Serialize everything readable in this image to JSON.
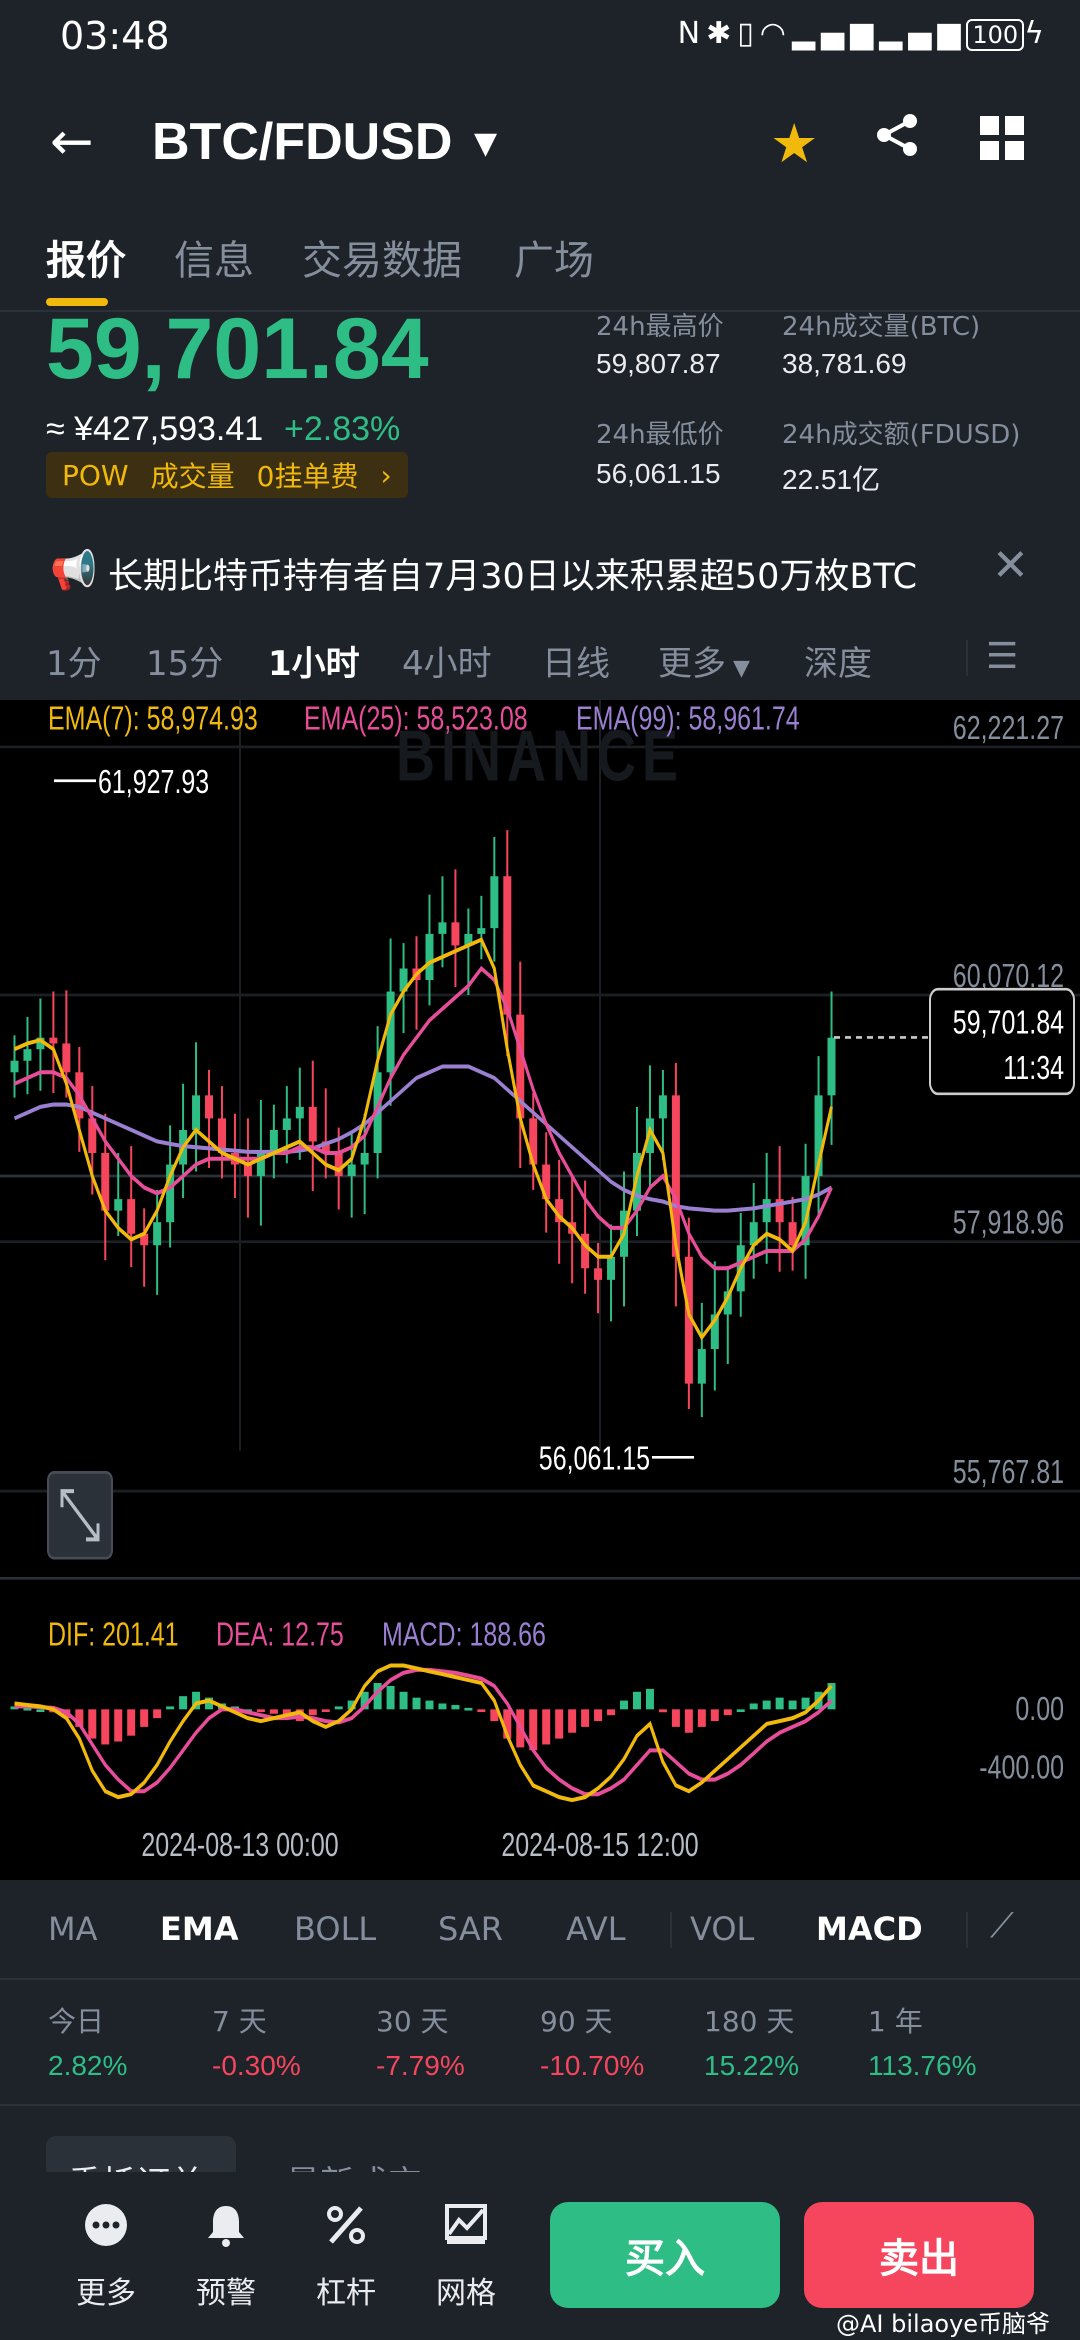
{
  "status_bar": {
    "time": "03:48",
    "battery": "100"
  },
  "header": {
    "back_icon": "arrow-left-icon",
    "pair": "BTC/FDUSD",
    "favorite_icon": "star-icon",
    "share_icon": "share-icon",
    "grid_icon": "grid-icon"
  },
  "tabs": [
    {
      "label": "报价",
      "active": true
    },
    {
      "label": "信息",
      "active": false
    },
    {
      "label": "交易数据",
      "active": false
    },
    {
      "label": "广场",
      "active": false
    }
  ],
  "price": {
    "last": "59,701.84",
    "cny": "≈ ¥427,593.41",
    "change": "+2.83%",
    "tags": [
      "POW",
      "成交量",
      "0挂单费"
    ]
  },
  "stats": {
    "high_label": "24h最高价",
    "high": "59,807.87",
    "vol_btc_label": "24h成交量(BTC)",
    "vol_btc": "38,781.69",
    "low_label": "24h最低价",
    "low": "56,061.15",
    "vol_q_label": "24h成交额(FDUSD)",
    "vol_q": "22.51亿"
  },
  "notice": {
    "text": "长期比特币持有者自7月30日以来积累超50万枚BTC"
  },
  "intervals": [
    {
      "label": "1分",
      "active": false
    },
    {
      "label": "15分",
      "active": false
    },
    {
      "label": "1小时",
      "active": true
    },
    {
      "label": "4小时",
      "active": false
    },
    {
      "label": "日线",
      "active": false
    },
    {
      "label": "更多",
      "active": false
    },
    {
      "label": "深度",
      "active": false
    }
  ],
  "chart_data": {
    "type": "candlestick",
    "title": "BTC/FDUSD 1h",
    "indicators": {
      "ema7_label": "EMA(7): 58,974.93",
      "ema25_label": "EMA(25): 58,523.08",
      "ema99_label": "EMA(99): 58,961.74"
    },
    "y_ticks": [
      "62,221.27",
      "60,070.12",
      "57,918.96",
      "55,767.81"
    ],
    "ylim": [
      55767.81,
      62221.27
    ],
    "last_price_label": "59,701.84",
    "countdown": "11:34",
    "annotations": {
      "high": "61,927.93",
      "low": "56,061.15"
    },
    "x_ticks": [
      "2024-08-13 00:00",
      "2024-08-15 12:00"
    ],
    "watermark": "BINANCE",
    "close_series": [
      59500,
      59600,
      59700,
      59650,
      59400,
      59000,
      58700,
      58200,
      58300,
      58000,
      57900,
      58100,
      58600,
      58900,
      59200,
      59000,
      58700,
      58600,
      58500,
      58700,
      58900,
      59000,
      59100,
      58800,
      58700,
      58500,
      58600,
      58700,
      59400,
      60100,
      60300,
      60200,
      60600,
      60700,
      60500,
      60600,
      60650,
      61100,
      59900,
      59000,
      58600,
      58300,
      58100,
      58000,
      57700,
      57600,
      57800,
      58200,
      58700,
      59000,
      59200,
      57800,
      56700,
      57000,
      57300,
      57500,
      57900,
      58100,
      58300,
      58100,
      57900,
      58500,
      59200,
      59700
    ],
    "ema7_series": [
      59600,
      59650,
      59680,
      59600,
      59300,
      58900,
      58500,
      58200,
      58050,
      57950,
      58000,
      58200,
      58500,
      58750,
      58900,
      58800,
      58700,
      58650,
      58600,
      58650,
      58700,
      58750,
      58800,
      58700,
      58600,
      58550,
      58650,
      59000,
      59500,
      59900,
      60100,
      60250,
      60350,
      60400,
      60450,
      60500,
      60550,
      60300,
      59600,
      59000,
      58600,
      58300,
      58150,
      58050,
      57900,
      57800,
      57800,
      58000,
      58500,
      58900,
      58700,
      57900,
      57300,
      57100,
      57250,
      57450,
      57700,
      57900,
      58000,
      57950,
      57850,
      58100,
      58600,
      59100
    ],
    "ema25_series": [
      59300,
      59350,
      59400,
      59400,
      59350,
      59200,
      59000,
      58800,
      58650,
      58500,
      58400,
      58350,
      58400,
      58500,
      58600,
      58650,
      58650,
      58650,
      58650,
      58650,
      58700,
      58700,
      58750,
      58750,
      58700,
      58700,
      58750,
      58850,
      59100,
      59350,
      59550,
      59700,
      59850,
      59950,
      60050,
      60150,
      60300,
      60200,
      59950,
      59600,
      59250,
      58950,
      58700,
      58500,
      58300,
      58150,
      58050,
      58050,
      58200,
      58400,
      58500,
      58300,
      58000,
      57800,
      57700,
      57700,
      57750,
      57800,
      57850,
      57850,
      57850,
      57950,
      58150,
      58400
    ],
    "ema99_series": [
      59000,
      59050,
      59100,
      59120,
      59120,
      59100,
      59050,
      59000,
      58950,
      58900,
      58850,
      58800,
      58780,
      58760,
      58750,
      58740,
      58730,
      58720,
      58710,
      58710,
      58710,
      58710,
      58720,
      58740,
      58780,
      58820,
      58880,
      58950,
      59050,
      59150,
      59250,
      59350,
      59400,
      59450,
      59450,
      59450,
      59400,
      59350,
      59250,
      59150,
      59050,
      58950,
      58850,
      58750,
      58650,
      58550,
      58450,
      58380,
      58330,
      58300,
      58280,
      58240,
      58220,
      58210,
      58200,
      58200,
      58210,
      58220,
      58240,
      58260,
      58280,
      58300,
      58340,
      58400
    ],
    "macd": {
      "dif_label": "DIF: 201.41",
      "dea_label": "DEA: 12.75",
      "macd_label": "MACD: 188.66",
      "y_ticks": [
        "0.00",
        "-400.00"
      ],
      "ylim": [
        -800,
        300
      ],
      "histogram": [
        20,
        10,
        0,
        -20,
        -60,
        -120,
        -200,
        -240,
        -220,
        -180,
        -120,
        -60,
        20,
        90,
        120,
        80,
        40,
        20,
        0,
        -10,
        -30,
        -60,
        -80,
        -40,
        -10,
        20,
        60,
        120,
        180,
        160,
        120,
        80,
        60,
        40,
        30,
        10,
        -10,
        -80,
        -200,
        -260,
        -280,
        -240,
        -200,
        -160,
        -120,
        -80,
        -40,
        60,
        120,
        140,
        -20,
        -120,
        -160,
        -120,
        -80,
        -40,
        0,
        40,
        60,
        80,
        60,
        80,
        120,
        180
      ],
      "dif": [
        40,
        30,
        20,
        0,
        -60,
        -200,
        -420,
        -560,
        -600,
        -580,
        -500,
        -380,
        -220,
        -80,
        40,
        60,
        20,
        -20,
        -60,
        -80,
        -60,
        -40,
        -20,
        -80,
        -120,
        -80,
        0,
        160,
        260,
        300,
        300,
        280,
        260,
        240,
        220,
        200,
        180,
        60,
        -180,
        -380,
        -520,
        -560,
        -600,
        -620,
        -600,
        -540,
        -460,
        -340,
        -180,
        -100,
        -360,
        -520,
        -560,
        -500,
        -420,
        -340,
        -260,
        -180,
        -100,
        -80,
        -60,
        -20,
        60,
        160
      ],
      "dea": [
        20,
        20,
        15,
        10,
        -20,
        -100,
        -240,
        -380,
        -480,
        -560,
        -560,
        -500,
        -400,
        -280,
        -160,
        -60,
        0,
        0,
        -20,
        -40,
        -60,
        -60,
        -50,
        -60,
        -80,
        -90,
        -60,
        20,
        120,
        200,
        250,
        270,
        270,
        260,
        250,
        230,
        210,
        160,
        40,
        -120,
        -280,
        -400,
        -480,
        -540,
        -580,
        -580,
        -540,
        -480,
        -380,
        -280,
        -280,
        -360,
        -440,
        -480,
        -480,
        -440,
        -380,
        -300,
        -220,
        -160,
        -120,
        -80,
        -20,
        60
      ]
    }
  },
  "indicator_tabs": [
    {
      "label": "MA",
      "active": false
    },
    {
      "label": "EMA",
      "active": true
    },
    {
      "label": "BOLL",
      "active": false
    },
    {
      "label": "SAR",
      "active": false
    },
    {
      "label": "AVL",
      "active": false
    },
    {
      "label": "VOL",
      "active": false
    },
    {
      "label": "MACD",
      "active": true
    }
  ],
  "performance": [
    {
      "label": "今日",
      "value": "2.82%",
      "up": true
    },
    {
      "label": "7 天",
      "value": "-0.30%",
      "up": false
    },
    {
      "label": "30 天",
      "value": "-7.79%",
      "up": false
    },
    {
      "label": "90 天",
      "value": "-10.70%",
      "up": false
    },
    {
      "label": "180 天",
      "value": "15.22%",
      "up": true
    },
    {
      "label": "1 年",
      "value": "113.76%",
      "up": true
    }
  ],
  "peek_tabs": [
    "委托订单",
    "最新成交"
  ],
  "bottom_nav": [
    {
      "label": "更多",
      "icon": "more-icon"
    },
    {
      "label": "预警",
      "icon": "bell-icon"
    },
    {
      "label": "杠杆",
      "icon": "leverage-icon"
    },
    {
      "label": "网格",
      "icon": "grid-trading-icon"
    }
  ],
  "actions": {
    "buy": "买入",
    "sell": "卖出"
  },
  "watermark": "@AI bilaoye币脑爷",
  "colors": {
    "up": "#2ebd85",
    "down": "#f6465d",
    "ema7": "#f0b90b",
    "ema25": "#e84d9a",
    "ema99": "#9b7fd1",
    "accent": "#f0b90b"
  }
}
